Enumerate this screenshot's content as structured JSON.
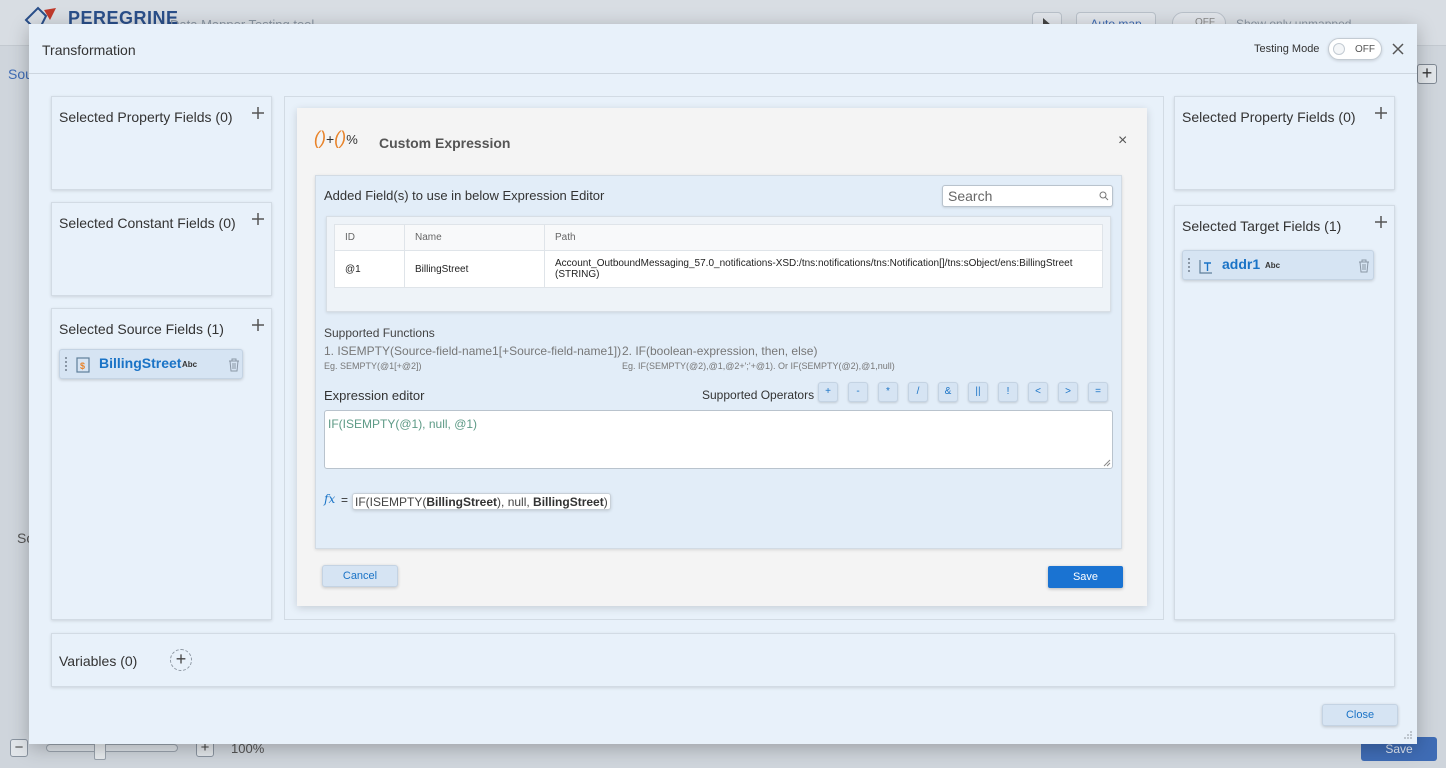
{
  "background": {
    "brand": "PEREGRINE",
    "subtitle": "Data Mapper  Testing tool",
    "auto_map_label": "Auto map",
    "toggle_label": "OFF",
    "show_unmapped_label": "Show only unmapped",
    "side_label_top": "Sou",
    "side_label_bottom": "So",
    "zoom_minus": "−",
    "zoom_plus": "+",
    "zoom_level": "100%",
    "save_label": "Save",
    "plus_label": "+"
  },
  "dialog": {
    "title": "Transformation",
    "testing_mode_label": "Testing Mode",
    "testing_mode_state": "OFF",
    "close_label": "Close"
  },
  "left_panels": {
    "property": {
      "title": "Selected Property Fields (0)"
    },
    "constant": {
      "title": "Selected Constant Fields (0)"
    },
    "source": {
      "title": "Selected Source Fields (1)",
      "field": {
        "name": "BillingStreet",
        "type": "Abc"
      }
    }
  },
  "right_panels": {
    "property": {
      "title": "Selected Property Fields (0)"
    },
    "target": {
      "title": "Selected Target Fields (1)",
      "field": {
        "name": "addr1",
        "type": "Abc"
      }
    }
  },
  "custom_expression": {
    "title": "Custom Expression",
    "icon_text": {
      "paren_open": "()",
      "plus": "+",
      "paren_close": "()",
      "pct": "%"
    },
    "close_glyph": "×",
    "added_fields_title": "Added Field(s) to use in below Expression Editor",
    "search_placeholder": "Search",
    "table": {
      "headers": [
        "ID",
        "Name",
        "Path"
      ],
      "rows": [
        {
          "id": "@1",
          "name": "BillingStreet",
          "path": "Account_OutboundMessaging_57.0_notifications-XSD:/tns:notifications/tns:Notification[]/tns:sObject/ens:BillingStreet (STRING)"
        }
      ]
    },
    "supported_functions_title": "Supported Functions",
    "functions": [
      {
        "signature": "1. ISEMPTY(Source-field-name1[+Source-field-name1])",
        "example": "Eg. SEMPTY(@1[+@2])"
      },
      {
        "signature": "2. IF(boolean-expression, then, else)",
        "example": "Eg. IF(SEMPTY(@2),@1,@2+';'+@1). Or IF(SEMPTY(@2),@1,null)"
      }
    ],
    "editor_label": "Expression editor",
    "operators_label": "Supported Operators",
    "operators": [
      "+",
      "-",
      "*",
      "/",
      "&",
      "||",
      "!",
      "<",
      ">",
      "="
    ],
    "expression": "IF(ISEMPTY(@1), null, @1)",
    "fx_symbol": "fx",
    "fx_equals": "=",
    "preview": {
      "part1": "IF(ISEMPTY(",
      "field1": "BillingStreet",
      "part2": "), null, ",
      "field2": "BillingStreet",
      "part3": ")"
    },
    "cancel_label": "Cancel",
    "save_label": "Save"
  },
  "variables": {
    "title": "Variables (0)",
    "add_glyph": "+"
  },
  "colors": {
    "accent": "#1a73d2",
    "panel_bg": "#e8f1fa",
    "chip_bg": "#d6e4f3",
    "icon_orange": "#e8832a",
    "expression_text": "#5d9a86"
  },
  "icons": {
    "close": "close-icon",
    "plus": "plus-icon",
    "search": "search-icon",
    "trash": "trash-icon",
    "source_field": "string-field-icon",
    "target_field": "text-field-icon"
  }
}
